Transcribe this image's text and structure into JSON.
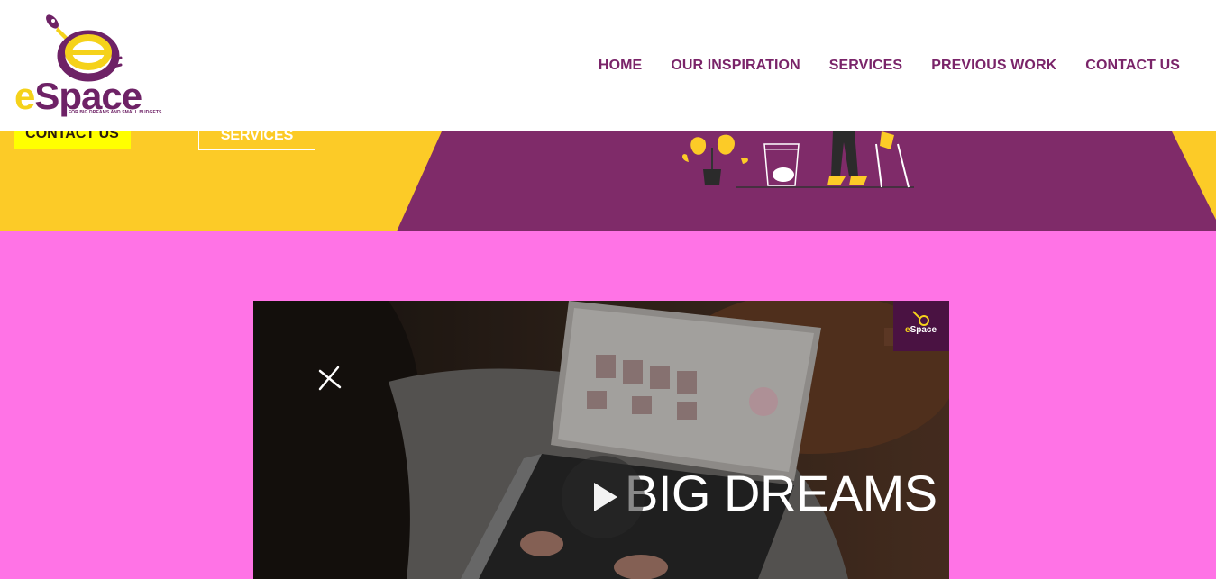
{
  "brand": {
    "logo_e": "e",
    "logo_rest": "Space",
    "tagline": "FOR BIG DREAMS AND SMALL BUDGETS",
    "colors": {
      "purple": "#6e2266",
      "yellow": "#f5d21b",
      "pink": "#ff73e6",
      "hero_yellow": "#fccb27",
      "hero_purple": "#7f2b69"
    }
  },
  "nav": {
    "items": [
      {
        "label": "HOME"
      },
      {
        "label": "OUR INSPIRATION"
      },
      {
        "label": "SERVICES"
      },
      {
        "label": "PREVIOUS WORK"
      },
      {
        "label": "CONTACT US"
      }
    ]
  },
  "hero": {
    "contact_button": "CONTACT US",
    "services_button": "SERVICES"
  },
  "video": {
    "title": "BIG DREAMS",
    "close_icon": "close-icon",
    "play_icon": "play-icon",
    "watermark_e": "e",
    "watermark_rest": "Space"
  }
}
